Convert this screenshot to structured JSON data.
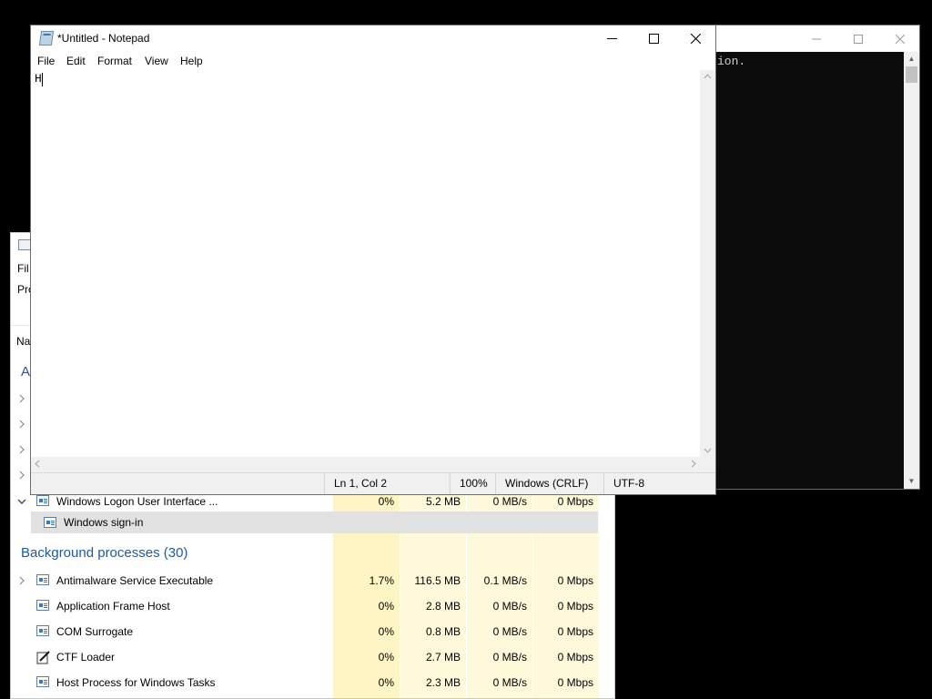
{
  "console": {
    "visible_text": "ion."
  },
  "task_manager": {
    "visible_fragments": {
      "menu_file": "Fil",
      "tab_processes": "Pro",
      "header_name": "Na",
      "section_apps": "A"
    },
    "apps_child_row": {
      "name": "Windows Logon User Interface ...",
      "cpu": "0%",
      "memory": "5.2 MB",
      "disk": "0 MB/s",
      "network": "0 Mbps"
    },
    "selected_subitem": {
      "name": "Windows sign-in"
    },
    "background_section": {
      "label": "Background processes (30)"
    },
    "processes": [
      {
        "name": "Antimalware Service Executable",
        "cpu": "1.7%",
        "memory": "116.5 MB",
        "disk": "0.1 MB/s",
        "network": "0 Mbps",
        "expandable": true,
        "icon": "app-window-icon"
      },
      {
        "name": "Application Frame Host",
        "cpu": "0%",
        "memory": "2.8 MB",
        "disk": "0 MB/s",
        "network": "0 Mbps",
        "expandable": false,
        "icon": "app-window-icon"
      },
      {
        "name": "COM Surrogate",
        "cpu": "0%",
        "memory": "0.8 MB",
        "disk": "0 MB/s",
        "network": "0 Mbps",
        "expandable": false,
        "icon": "app-window-icon"
      },
      {
        "name": "CTF Loader",
        "cpu": "0%",
        "memory": "2.7 MB",
        "disk": "0 MB/s",
        "network": "0 Mbps",
        "expandable": false,
        "icon": "pen-icon"
      },
      {
        "name": "Host Process for Windows Tasks",
        "cpu": "0%",
        "memory": "2.3 MB",
        "disk": "0 MB/s",
        "network": "0 Mbps",
        "expandable": false,
        "icon": "app-window-icon"
      }
    ],
    "colors": {
      "cpu_column": "#fff4c4",
      "other_columns": "#fff9dc",
      "section_text": "#1e5aa0",
      "selected_row": "#e1e1e1"
    }
  },
  "notepad": {
    "title": "*Untitled - Notepad",
    "menu": {
      "file": "File",
      "edit": "Edit",
      "format": "Format",
      "view": "View",
      "help": "Help"
    },
    "content": "H",
    "status": {
      "position": "Ln 1, Col 2",
      "zoom": "100%",
      "line_endings": "Windows (CRLF)",
      "encoding": "UTF-8"
    }
  }
}
